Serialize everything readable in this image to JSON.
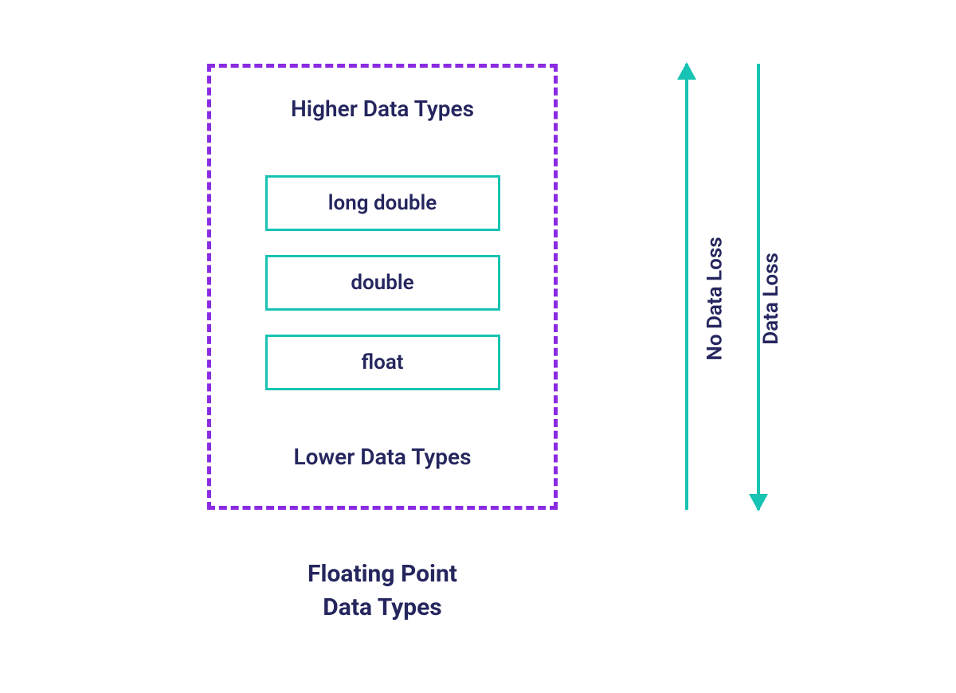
{
  "diagram": {
    "header": "Higher Data Types",
    "footer": "Lower Data Types",
    "types": [
      "long double",
      "double",
      "float"
    ],
    "caption_line1": "Floating Point",
    "caption_line2": "Data Types"
  },
  "arrows": {
    "up_label": "No Data Loss",
    "down_label": "Data Loss"
  }
}
